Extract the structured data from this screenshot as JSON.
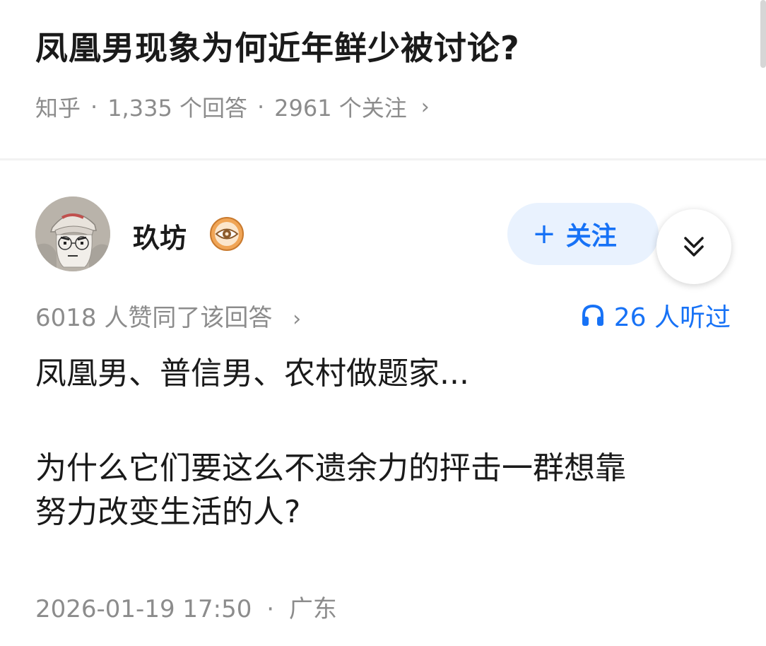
{
  "question": {
    "title": "凤凰男现象为何近年鲜少被讨论?",
    "source": "知乎",
    "answers": "1,335 个回答",
    "followers": "2961 个关注",
    "separator": "·",
    "chevron": "›"
  },
  "author": {
    "name": "玖坊",
    "avatar": "avatar-cartoon-cap",
    "badge_icon": "eye-badge-icon"
  },
  "actions": {
    "follow_label": "关注",
    "follow_plus": "+",
    "expand_icon": "double-chevron-down-icon"
  },
  "stats": {
    "upvotes": "6018 人赞同了该回答",
    "upvotes_chevron": "›",
    "listeners": "26 人听过",
    "listen_icon": "headphones-icon"
  },
  "answer": {
    "paragraph1": "凤凰男、普信男、农村做题家...",
    "paragraph2_line1": "为什么它们要这么不遗余力的抨击一群想靠",
    "paragraph2_line2": "努力改变生活的人?"
  },
  "footer": {
    "datetime": "2026-01-19 17:50",
    "separator": "·",
    "location": "广东"
  },
  "colors": {
    "accent": "#1772f6",
    "follow_bg": "#e9f2fe",
    "muted_text": "#8c8c8c",
    "primary_text": "#1a1a1a"
  }
}
